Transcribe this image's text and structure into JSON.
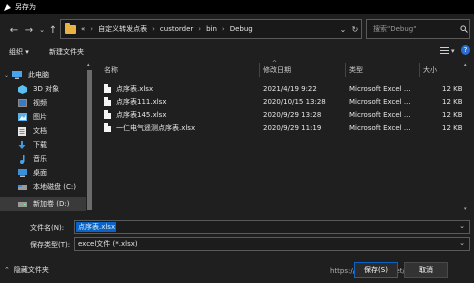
{
  "window": {
    "title": "另存为"
  },
  "address": {
    "crumbs": [
      "«",
      "自定义转发点表",
      "custorder",
      "bin",
      "Debug"
    ],
    "search_placeholder": "搜索\"Debug\""
  },
  "toolbar": {
    "organize": "组织 ▾",
    "new_folder": "新建文件夹"
  },
  "sidebar": {
    "items": [
      {
        "label": "此电脑",
        "icon": "computer-icon"
      },
      {
        "label": "3D 对象",
        "icon": "3d-objects-icon"
      },
      {
        "label": "视频",
        "icon": "video-icon"
      },
      {
        "label": "图片",
        "icon": "pictures-icon"
      },
      {
        "label": "文档",
        "icon": "documents-icon"
      },
      {
        "label": "下载",
        "icon": "downloads-icon"
      },
      {
        "label": "音乐",
        "icon": "music-icon"
      },
      {
        "label": "桌面",
        "icon": "desktop-icon"
      },
      {
        "label": "本地磁盘 (C:)",
        "icon": "drive-icon"
      },
      {
        "label": "新加卷 (D:)",
        "icon": "drive-icon"
      }
    ]
  },
  "filelist": {
    "headers": {
      "name": "名称",
      "date": "修改日期",
      "type": "类型",
      "size": "大小"
    },
    "rows": [
      {
        "name": "点序表.xlsx",
        "date": "2021/4/19 9:22",
        "type": "Microsoft Excel ...",
        "size": "12 KB"
      },
      {
        "name": "点序表111.xlsx",
        "date": "2020/10/15 13:28",
        "type": "Microsoft Excel ...",
        "size": "12 KB"
      },
      {
        "name": "点序表145.xlsx",
        "date": "2020/9/29 13:28",
        "type": "Microsoft Excel ...",
        "size": "12 KB"
      },
      {
        "name": "一仁电气遥测点序表.xlsx",
        "date": "2020/9/29 11:19",
        "type": "Microsoft Excel ...",
        "size": "12 KB"
      }
    ]
  },
  "form": {
    "filename_label": "文件名(N):",
    "filename_value": "点序表.xlsx",
    "type_label": "保存类型(T):",
    "type_value": "excel文件 (*.xlsx)"
  },
  "footer": {
    "hide_folders": "隐藏文件夹",
    "save": "保存(S)",
    "cancel": "取消",
    "watermark": "https://blog.csdn.net/mainmaster"
  }
}
